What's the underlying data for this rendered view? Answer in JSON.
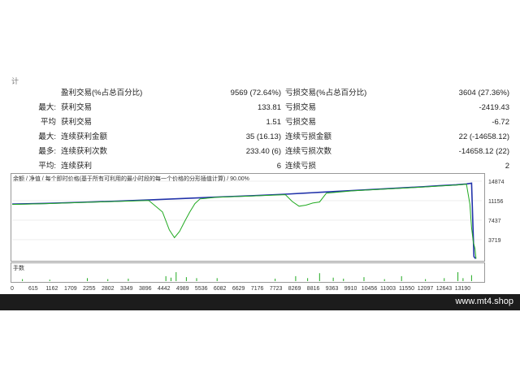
{
  "header_fragment": "计",
  "stats": [
    {
      "prefix": "",
      "left_label": "盈利交易(%占总百分比)",
      "left_value": "9569 (72.64%)",
      "right_label": "亏损交易(%占总百分比)",
      "right_value": "3604 (27.36%)"
    },
    {
      "prefix": "最大:",
      "left_label": "获利交易",
      "left_value": "133.81",
      "right_label": "亏损交易",
      "right_value": "-2419.43"
    },
    {
      "prefix": "平均",
      "left_label": "获利交易",
      "left_value": "1.51",
      "right_label": "亏损交易",
      "right_value": "-6.72"
    },
    {
      "prefix": "最大:",
      "left_label": "连续获利金额",
      "left_value": "35 (16.13)",
      "right_label": "连续亏损金额",
      "right_value": "22 (-14658.12)"
    },
    {
      "prefix": "最多:",
      "left_label": "连续获利次数",
      "left_value": "233.40 (6)",
      "right_label": "连续亏损次数",
      "right_value": "-14658.12 (22)"
    },
    {
      "prefix": "平均:",
      "left_label": "连续获利",
      "left_value": "6",
      "right_label": "连续亏损",
      "right_value": "2"
    }
  ],
  "chart_data": {
    "type": "line",
    "legend_text": "余额 / 净值 / 每个即时价格(基于所有可利用的最小时段的每一个价格的分形插值计算) / 90.00%",
    "legend_items": [
      {
        "label": "余额",
        "color": "#2233aa"
      },
      {
        "label": "净值",
        "color": "#22aa22"
      }
    ],
    "y_ticks": [
      14874,
      11156,
      7437,
      3719
    ],
    "ylim": [
      0,
      14874
    ],
    "x_ticks": [
      0,
      615,
      1162,
      1709,
      2255,
      2802,
      3349,
      3896,
      4442,
      4989,
      5536,
      6082,
      6629,
      7176,
      7723,
      8269,
      8816,
      9363,
      9910,
      10456,
      11003,
      11550,
      12097,
      12643,
      13190
    ],
    "xlim": [
      0,
      13750
    ],
    "series": [
      {
        "name": "余额",
        "x": [
          0,
          1000,
          2000,
          3000,
          4000,
          5000,
          6000,
          7000,
          8000,
          9000,
          10000,
          11000,
          12000,
          12500,
          13000,
          13300,
          13450,
          13520,
          13570
        ],
        "values": [
          10500,
          10650,
          10850,
          11050,
          11300,
          11580,
          11850,
          12100,
          12400,
          12750,
          13100,
          13450,
          13800,
          14000,
          14200,
          14350,
          14500,
          500,
          100
        ]
      },
      {
        "name": "净值",
        "x": [
          0,
          1000,
          2000,
          3000,
          4000,
          4400,
          4600,
          4750,
          4900,
          5050,
          5200,
          5350,
          5500,
          6000,
          7000,
          8000,
          8200,
          8400,
          8600,
          8800,
          9000,
          9200,
          10000,
          11000,
          12000,
          12500,
          13000,
          13300,
          13400,
          13450,
          13500,
          13550,
          13580
        ],
        "values": [
          10450,
          10600,
          10800,
          11000,
          11200,
          9000,
          5600,
          4100,
          5300,
          7200,
          9000,
          10600,
          11500,
          11800,
          12050,
          12300,
          11000,
          10100,
          10300,
          10700,
          10900,
          12600,
          13050,
          13400,
          13750,
          13950,
          14150,
          14300,
          10500,
          6000,
          3300,
          2000,
          100
        ]
      }
    ],
    "volume_label": "手数",
    "volume": {
      "x": [
        300,
        1100,
        2200,
        2800,
        3400,
        4500,
        4650,
        4800,
        5100,
        5400,
        6000,
        7700,
        8300,
        8650,
        9000,
        9400,
        9700,
        10300,
        10900,
        11400,
        12100,
        12650,
        13050,
        13200,
        13450
      ],
      "values": [
        0.2,
        0.15,
        0.3,
        0.2,
        0.25,
        0.5,
        0.35,
        0.9,
        0.4,
        0.3,
        0.3,
        0.25,
        0.5,
        0.3,
        0.8,
        0.35,
        0.25,
        0.4,
        0.2,
        0.5,
        0.2,
        0.3,
        0.9,
        0.3,
        0.6
      ]
    }
  },
  "footer": {
    "site": "www.mt4.shop"
  }
}
